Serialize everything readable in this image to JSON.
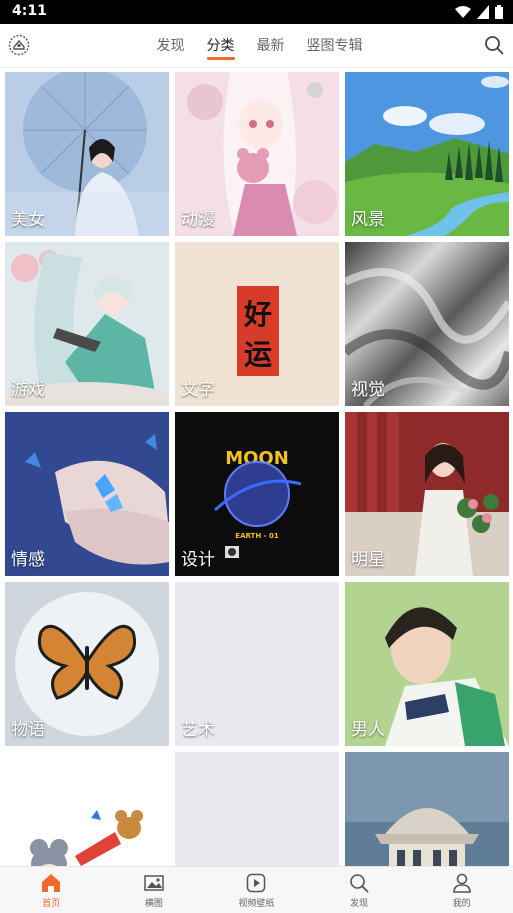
{
  "status": {
    "time": "4:11"
  },
  "tabs": [
    {
      "label": "发现",
      "active": false
    },
    {
      "label": "分类",
      "active": true
    },
    {
      "label": "最新",
      "active": false
    },
    {
      "label": "竖图专辑",
      "active": false
    }
  ],
  "categories": [
    {
      "label": "美女"
    },
    {
      "label": "动漫"
    },
    {
      "label": "风景"
    },
    {
      "label": "游戏"
    },
    {
      "label": "文字"
    },
    {
      "label": "视觉"
    },
    {
      "label": "情感"
    },
    {
      "label": "设计"
    },
    {
      "label": "明星"
    },
    {
      "label": "物语"
    },
    {
      "label": "艺术"
    },
    {
      "label": "男人"
    },
    {
      "label": ""
    },
    {
      "label": ""
    },
    {
      "label": ""
    }
  ],
  "art_text": {
    "good_luck_1": "好",
    "good_luck_2": "运",
    "poster_title": "MOON",
    "poster_sub": "EARTH - 01"
  },
  "bottom_nav": [
    {
      "label": "首页",
      "icon": "home-icon",
      "active": true
    },
    {
      "label": "横图",
      "icon": "image-icon",
      "active": false
    },
    {
      "label": "视频壁纸",
      "icon": "video-icon",
      "active": false
    },
    {
      "label": "发现",
      "icon": "discover-icon",
      "active": false
    },
    {
      "label": "我的",
      "icon": "user-icon",
      "active": false
    }
  ],
  "colors": {
    "accent": "#f06a2c",
    "status_bar": "#000000"
  }
}
